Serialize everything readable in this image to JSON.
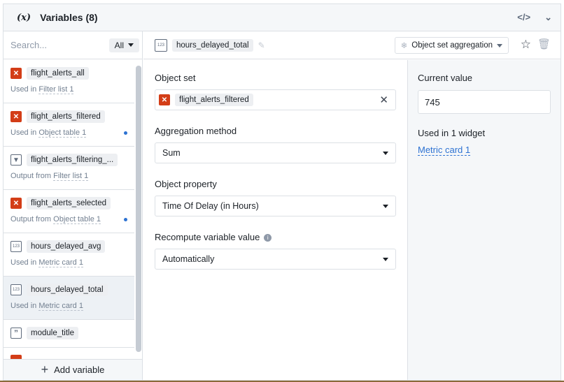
{
  "header": {
    "icon": "(x)",
    "title": "Variables (8)",
    "code_icon": "</>",
    "collapse_icon": "⌄"
  },
  "sidebar": {
    "search_placeholder": "Search...",
    "filter": "All",
    "items": [
      {
        "name": "flight_alerts_all",
        "icon": "object-set-icon",
        "prefix": "Used in",
        "link": "Filter list 1",
        "dot": false
      },
      {
        "name": "flight_alerts_filtered",
        "icon": "object-set-icon",
        "prefix": "Used in",
        "link": "Object table 1",
        "dot": true
      },
      {
        "name": "flight_alerts_filtering_...",
        "icon": "filter-icon",
        "prefix": "Output from",
        "link": "Filter list 1",
        "dot": false
      },
      {
        "name": "flight_alerts_selected",
        "icon": "object-set-icon",
        "prefix": "Output from",
        "link": "Object table 1",
        "dot": true
      },
      {
        "name": "hours_delayed_avg",
        "icon": "numeric-icon",
        "prefix": "Used in",
        "link": "Metric card 1",
        "dot": false
      },
      {
        "name": "hours_delayed_total",
        "icon": "numeric-icon",
        "prefix": "Used in",
        "link": "Metric card 1",
        "dot": false,
        "selected": true
      },
      {
        "name": "module_title",
        "icon": "string-icon",
        "prefix": "",
        "link": "",
        "dot": false
      }
    ],
    "add_label": "Add variable"
  },
  "toolbar": {
    "variable_name": "hours_delayed_total",
    "type_badge": "123",
    "type_select": "Object set aggregation"
  },
  "form": {
    "object_set_label": "Object set",
    "object_set_value": "flight_alerts_filtered",
    "aggregation_label": "Aggregation method",
    "aggregation_value": "Sum",
    "property_label": "Object property",
    "property_value": "Time Of Delay (in Hours)",
    "recompute_label": "Recompute variable value",
    "recompute_value": "Automatically"
  },
  "details": {
    "current_value_label": "Current value",
    "current_value": "745",
    "used_in_label": "Used in 1 widget",
    "widget_link": "Metric card 1"
  },
  "colors": {
    "accent": "#2d72d2",
    "object_set": "#d33d17"
  }
}
